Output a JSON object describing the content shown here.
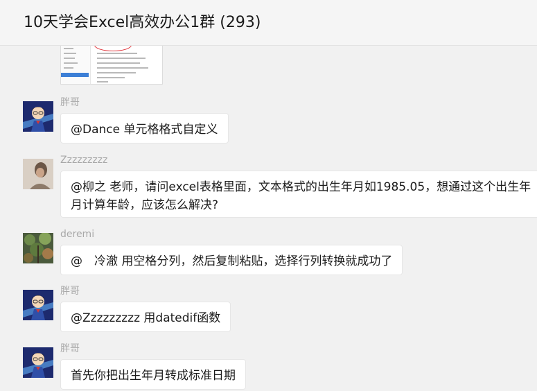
{
  "window": {
    "title": "10天学会Excel高效办公1群 (293)"
  },
  "messages": [
    {
      "sender": "胖哥",
      "avatar": "anime-boy-avatar",
      "text": "@Dance 单元格格式自定义"
    },
    {
      "sender": "Zzzzzzzzz",
      "avatar": "person-photo-avatar",
      "text": "@柳之 老师，请问excel表格里面，文本格式的出生年月如1985.05，想通过这个出生年月计算年龄，应该怎么解决?"
    },
    {
      "sender": "deremi",
      "avatar": "plant-photo-avatar",
      "text": "@　冷澈 用空格分列，然后复制粘贴，选择行列转换就成功了"
    },
    {
      "sender": "胖哥",
      "avatar": "anime-boy-avatar",
      "text": "@Zzzzzzzzz 用datedif函数"
    },
    {
      "sender": "胖哥",
      "avatar": "anime-boy-avatar",
      "text": "首先你把出生年月转成标准日期"
    }
  ],
  "colors": {
    "background": "#f1f1f1",
    "bubble": "#ffffff",
    "sender_name": "#a8a8a8",
    "text": "#1b1b1b"
  }
}
